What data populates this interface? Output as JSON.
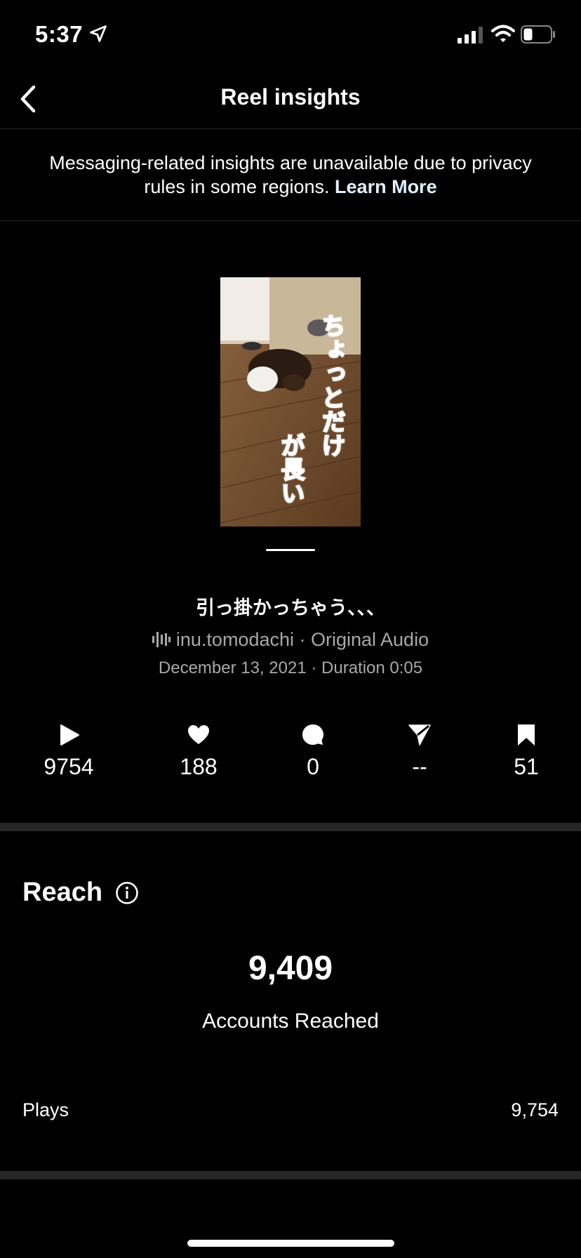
{
  "status_bar": {
    "time": "5:37"
  },
  "header": {
    "title": "Reel insights"
  },
  "notice": {
    "text": "Messaging-related insights are unavailable due to privacy rules in some regions.",
    "link": "Learn More"
  },
  "thumbnail": {
    "caption_line1": "ちょっとだけ",
    "caption_line2": "が長い"
  },
  "reel": {
    "title": "引っ掛かっちゃう、、、",
    "audio": "inu.tomodachi · Original Audio",
    "date_duration": "December 13, 2021 · Duration 0:05"
  },
  "stats": {
    "plays": "9754",
    "likes": "188",
    "comments": "0",
    "shares": "--",
    "saves": "51"
  },
  "reach": {
    "title": "Reach",
    "value": "9,409",
    "label": "Accounts Reached",
    "plays_label": "Plays",
    "plays_value": "9,754"
  },
  "icons": {
    "back": "chevron-left-icon",
    "info": "info-icon",
    "play": "play-icon",
    "like": "heart-icon",
    "comment": "comment-icon",
    "share": "paper-plane-icon",
    "save": "bookmark-icon"
  }
}
